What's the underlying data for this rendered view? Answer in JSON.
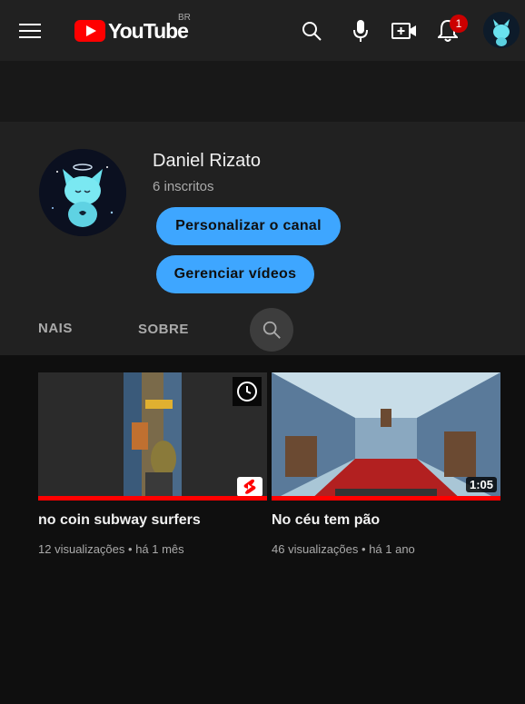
{
  "header": {
    "logo_text": "YouTube",
    "country_code": "BR",
    "notification_count": "1",
    "icons": [
      "menu-icon",
      "search-icon",
      "microphone-icon",
      "create-video-icon",
      "bell-icon"
    ]
  },
  "channel": {
    "name": "Daniel Rizato",
    "subscribers": "6 inscritos",
    "customize_label": "Personalizar o canal",
    "manage_label": "Gerenciar vídeos"
  },
  "tabs": [
    {
      "label": "NAIS",
      "visible_text": "NAIS"
    },
    {
      "label": "SOBRE"
    }
  ],
  "videos": [
    {
      "title": "no coin subway surfers",
      "views": "12 visualizações",
      "age": "há 1 mês",
      "is_short": true,
      "watched_fraction": 1.0
    },
    {
      "title": "No céu tem pão",
      "views": "46 visualizações",
      "age": "há 1 ano",
      "duration": "1:05",
      "watched_fraction": 1.0
    }
  ],
  "colors": {
    "accent": "#3ea6ff",
    "brand": "#ff0000",
    "background": "#0f0f0f",
    "surface": "#212121"
  }
}
